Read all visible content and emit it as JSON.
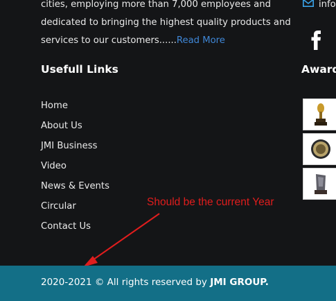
{
  "about": {
    "line1": "cities, employing more than 7,000 employees and",
    "line2": "dedicated to bringing the highest quality products and",
    "line3": "services to our customers......",
    "read_more": "Read More"
  },
  "useful_links": {
    "title": "Usefull Links",
    "items": [
      {
        "label": "Home"
      },
      {
        "label": "About Us"
      },
      {
        "label": "JMI Business"
      },
      {
        "label": "Video"
      },
      {
        "label": "News & Events"
      },
      {
        "label": "Circular"
      },
      {
        "label": "Contact Us"
      }
    ]
  },
  "contact": {
    "email_partial": "info"
  },
  "social": {
    "facebook_icon": "facebook-icon"
  },
  "awards": {
    "title": "Award",
    "items": [
      "trophy-award",
      "medal-award",
      "crystal-award"
    ]
  },
  "annotation": {
    "text": "Should be the current Year",
    "color": "#e01d1d"
  },
  "footer": {
    "copyright": "2020-2021 © All rights reserved by ",
    "brand": "JMI GROUP.",
    "background": "#136f87"
  },
  "colors": {
    "page_bg": "#141517",
    "link_accent": "#3f86d6",
    "mail_icon": "#3aa3e8"
  }
}
